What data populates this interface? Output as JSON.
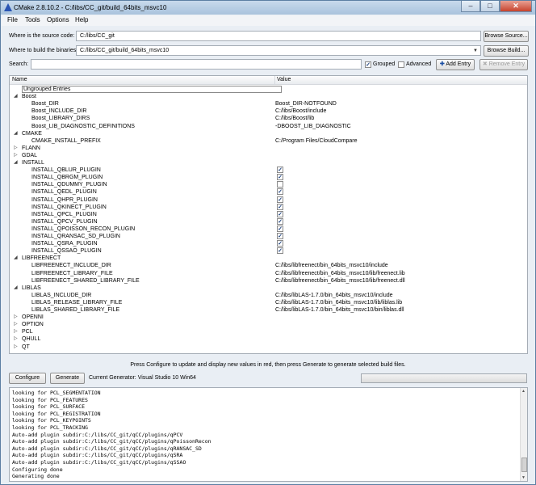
{
  "window": {
    "title": "CMake 2.8.10.2 - C:/libs/CC_git/build_64bits_msvc10"
  },
  "menu": [
    "File",
    "Tools",
    "Options",
    "Help"
  ],
  "source": {
    "label": "Where is the source code:",
    "value": "C:/libs/CC_git",
    "button": "Browse Source..."
  },
  "binaries": {
    "label": "Where to build the binaries:",
    "value": "C:/libs/CC_git/build_64bits_msvc10",
    "button": "Browse Build..."
  },
  "search": {
    "label": "Search:",
    "value": ""
  },
  "options": {
    "grouped": "Grouped",
    "advanced": "Advanced",
    "add_entry": "Add Entry",
    "remove_entry": "Remove Entry"
  },
  "tree": {
    "col_name": "Name",
    "col_value": "Value",
    "rows": [
      {
        "name": "Ungrouped Entries",
        "level": 0,
        "type": "ungrouped"
      },
      {
        "name": "Boost",
        "level": 0,
        "type": "group",
        "expanded": true
      },
      {
        "name": "Boost_DIR",
        "level": 1,
        "value": "Boost_DIR-NOTFOUND"
      },
      {
        "name": "Boost_INCLUDE_DIR",
        "level": 1,
        "value": "C:/libs/Boost/include"
      },
      {
        "name": "Boost_LIBRARY_DIRS",
        "level": 1,
        "value": "C:/libs/Boost/lib"
      },
      {
        "name": "Boost_LIB_DIAGNOSTIC_DEFINITIONS",
        "level": 1,
        "value": "-DBOOST_LIB_DIAGNOSTIC"
      },
      {
        "name": "CMAKE",
        "level": 0,
        "type": "group",
        "expanded": true
      },
      {
        "name": "CMAKE_INSTALL_PREFIX",
        "level": 1,
        "value": "C:/Program Files/CloudCompare"
      },
      {
        "name": "FLANN",
        "level": 0,
        "type": "group",
        "expanded": false
      },
      {
        "name": "GDAL",
        "level": 0,
        "type": "group",
        "expanded": false
      },
      {
        "name": "INSTALL",
        "level": 0,
        "type": "group",
        "expanded": true
      },
      {
        "name": "INSTALL_QBLUR_PLUGIN",
        "level": 1,
        "checked": true
      },
      {
        "name": "INSTALL_QBRGM_PLUGIN",
        "level": 1,
        "checked": true
      },
      {
        "name": "INSTALL_QDUMMY_PLUGIN",
        "level": 1,
        "checked": false
      },
      {
        "name": "INSTALL_QEDL_PLUGIN",
        "level": 1,
        "checked": true
      },
      {
        "name": "INSTALL_QHPR_PLUGIN",
        "level": 1,
        "checked": true
      },
      {
        "name": "INSTALL_QKINECT_PLUGIN",
        "level": 1,
        "checked": true
      },
      {
        "name": "INSTALL_QPCL_PLUGIN",
        "level": 1,
        "checked": true
      },
      {
        "name": "INSTALL_QPCV_PLUGIN",
        "level": 1,
        "checked": true
      },
      {
        "name": "INSTALL_QPOISSON_RECON_PLUGIN",
        "level": 1,
        "checked": true
      },
      {
        "name": "INSTALL_QRANSAC_SD_PLUGIN",
        "level": 1,
        "checked": true
      },
      {
        "name": "INSTALL_QSRA_PLUGIN",
        "level": 1,
        "checked": true
      },
      {
        "name": "INSTALL_QSSAO_PLUGIN",
        "level": 1,
        "checked": true
      },
      {
        "name": "LIBFREENECT",
        "level": 0,
        "type": "group",
        "expanded": true
      },
      {
        "name": "LIBFREENECT_INCLUDE_DIR",
        "level": 1,
        "value": "C:/libs/libfreenect/bin_64bits_msvc10/include"
      },
      {
        "name": "LIBFREENECT_LIBRARY_FILE",
        "level": 1,
        "value": "C:/libs/libfreenect/bin_64bits_msvc10/lib/freenect.lib"
      },
      {
        "name": "LIBFREENECT_SHARED_LIBRARY_FILE",
        "level": 1,
        "value": "C:/libs/libfreenect/bin_64bits_msvc10/lib/freenect.dll"
      },
      {
        "name": "LIBLAS",
        "level": 0,
        "type": "group",
        "expanded": true
      },
      {
        "name": "LIBLAS_INCLUDE_DIR",
        "level": 1,
        "value": "C:/libs/libLAS-1.7.0/bin_64bits_msvc10/include"
      },
      {
        "name": "LIBLAS_RELEASE_LIBRARY_FILE",
        "level": 1,
        "value": "C:/libs/libLAS-1.7.0/bin_64bits_msvc10/lib/liblas.lib"
      },
      {
        "name": "LIBLAS_SHARED_LIBRARY_FILE",
        "level": 1,
        "value": "C:/libs/libLAS-1.7.0/bin_64bits_msvc10/bin/liblas.dll"
      },
      {
        "name": "OPENNI",
        "level": 0,
        "type": "group",
        "expanded": false
      },
      {
        "name": "OPTION",
        "level": 0,
        "type": "group",
        "expanded": false
      },
      {
        "name": "PCL",
        "level": 0,
        "type": "group",
        "expanded": false
      },
      {
        "name": "QHULL",
        "level": 0,
        "type": "group",
        "expanded": false
      },
      {
        "name": "QT",
        "level": 0,
        "type": "group",
        "expanded": false
      }
    ]
  },
  "hint": "Press Configure to update and display new values in red, then press Generate to generate selected build files.",
  "actions": {
    "configure": "Configure",
    "generate": "Generate",
    "generator": "Current Generator: Visual Studio 10 Win64"
  },
  "log": [
    "looking for PCL_SEGMENTATION",
    "looking for PCL_FEATURES",
    "looking for PCL_SURFACE",
    "looking for PCL_REGISTRATION",
    "looking for PCL_KEYPOINTS",
    "looking for PCL_TRACKING",
    "Auto-add plugin subdir:C:/libs/CC_git/qCC/plugins/qPCV",
    "Auto-add plugin subdir:C:/libs/CC_git/qCC/plugins/qPoissonRecon",
    "Auto-add plugin subdir:C:/libs/CC_git/qCC/plugins/qRANSAC_SD",
    "Auto-add plugin subdir:C:/libs/CC_git/qCC/plugins/qSRA",
    "Auto-add plugin subdir:C:/libs/CC_git/qCC/plugins/qSSAO",
    "Configuring done",
    "Generating done"
  ]
}
